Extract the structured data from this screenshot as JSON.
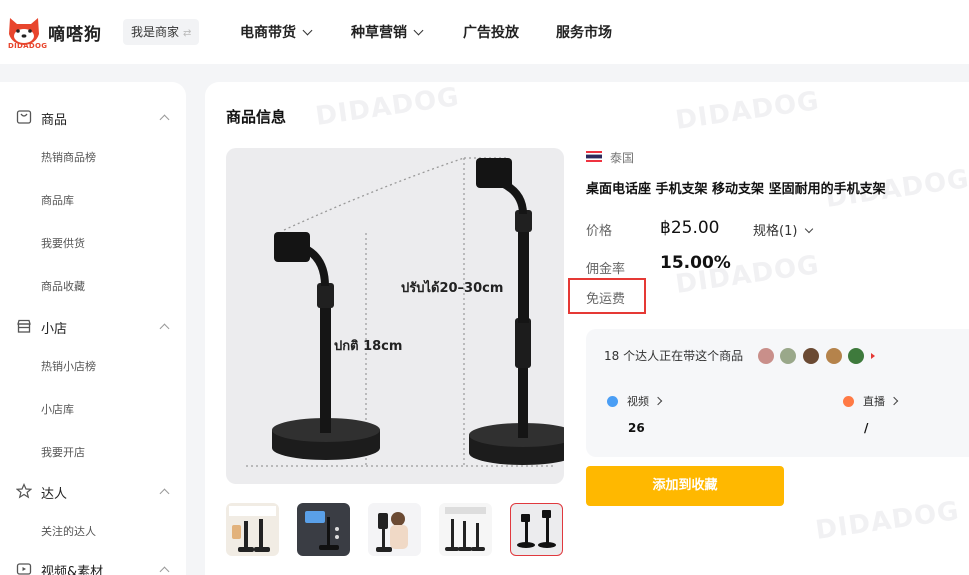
{
  "header": {
    "brand": "嘀嗒狗",
    "brand_sub": "DIDADOG",
    "merchant_label": "我是商家",
    "merchant_swap_icon": "⇄",
    "nav": [
      "电商带货",
      "种草营销",
      "广告投放",
      "服务市场"
    ]
  },
  "sidebar": {
    "sections": [
      {
        "label": "商品",
        "icon": "product-icon",
        "items": [
          "热销商品榜",
          "商品库",
          "我要供货",
          "商品收藏"
        ]
      },
      {
        "label": "小店",
        "icon": "shop-icon",
        "items": [
          "热销小店榜",
          "小店库",
          "我要开店"
        ]
      },
      {
        "label": "达人",
        "icon": "star-icon",
        "items": [
          "关注的达人"
        ]
      },
      {
        "label": "视频&素材",
        "icon": "video-icon",
        "items": []
      }
    ]
  },
  "main": {
    "title": "商品信息",
    "watermark": "DIDADOG",
    "image_texts": {
      "left": "ปกติ 18cm",
      "right": "ปรับได้20–30cm"
    },
    "country": "泰国",
    "product_title": "桌面电话座 手机支架 移动支架 坚固耐用的手机支架",
    "price_label": "价格",
    "price": "฿25.00",
    "spec": "规格(1)",
    "commission_label": "佣金率",
    "commission": "15.00%",
    "shipping_label": "免运费",
    "influencers_text": "18 个达人正在带这个商品",
    "stats": [
      {
        "label": "视频",
        "value": "26"
      },
      {
        "label": "直播",
        "value": "/"
      }
    ],
    "add_button": "添加到收藏"
  },
  "colors": {
    "accent": "#ffb800",
    "highlight_border": "#e53935",
    "brand": "#e8452d"
  }
}
